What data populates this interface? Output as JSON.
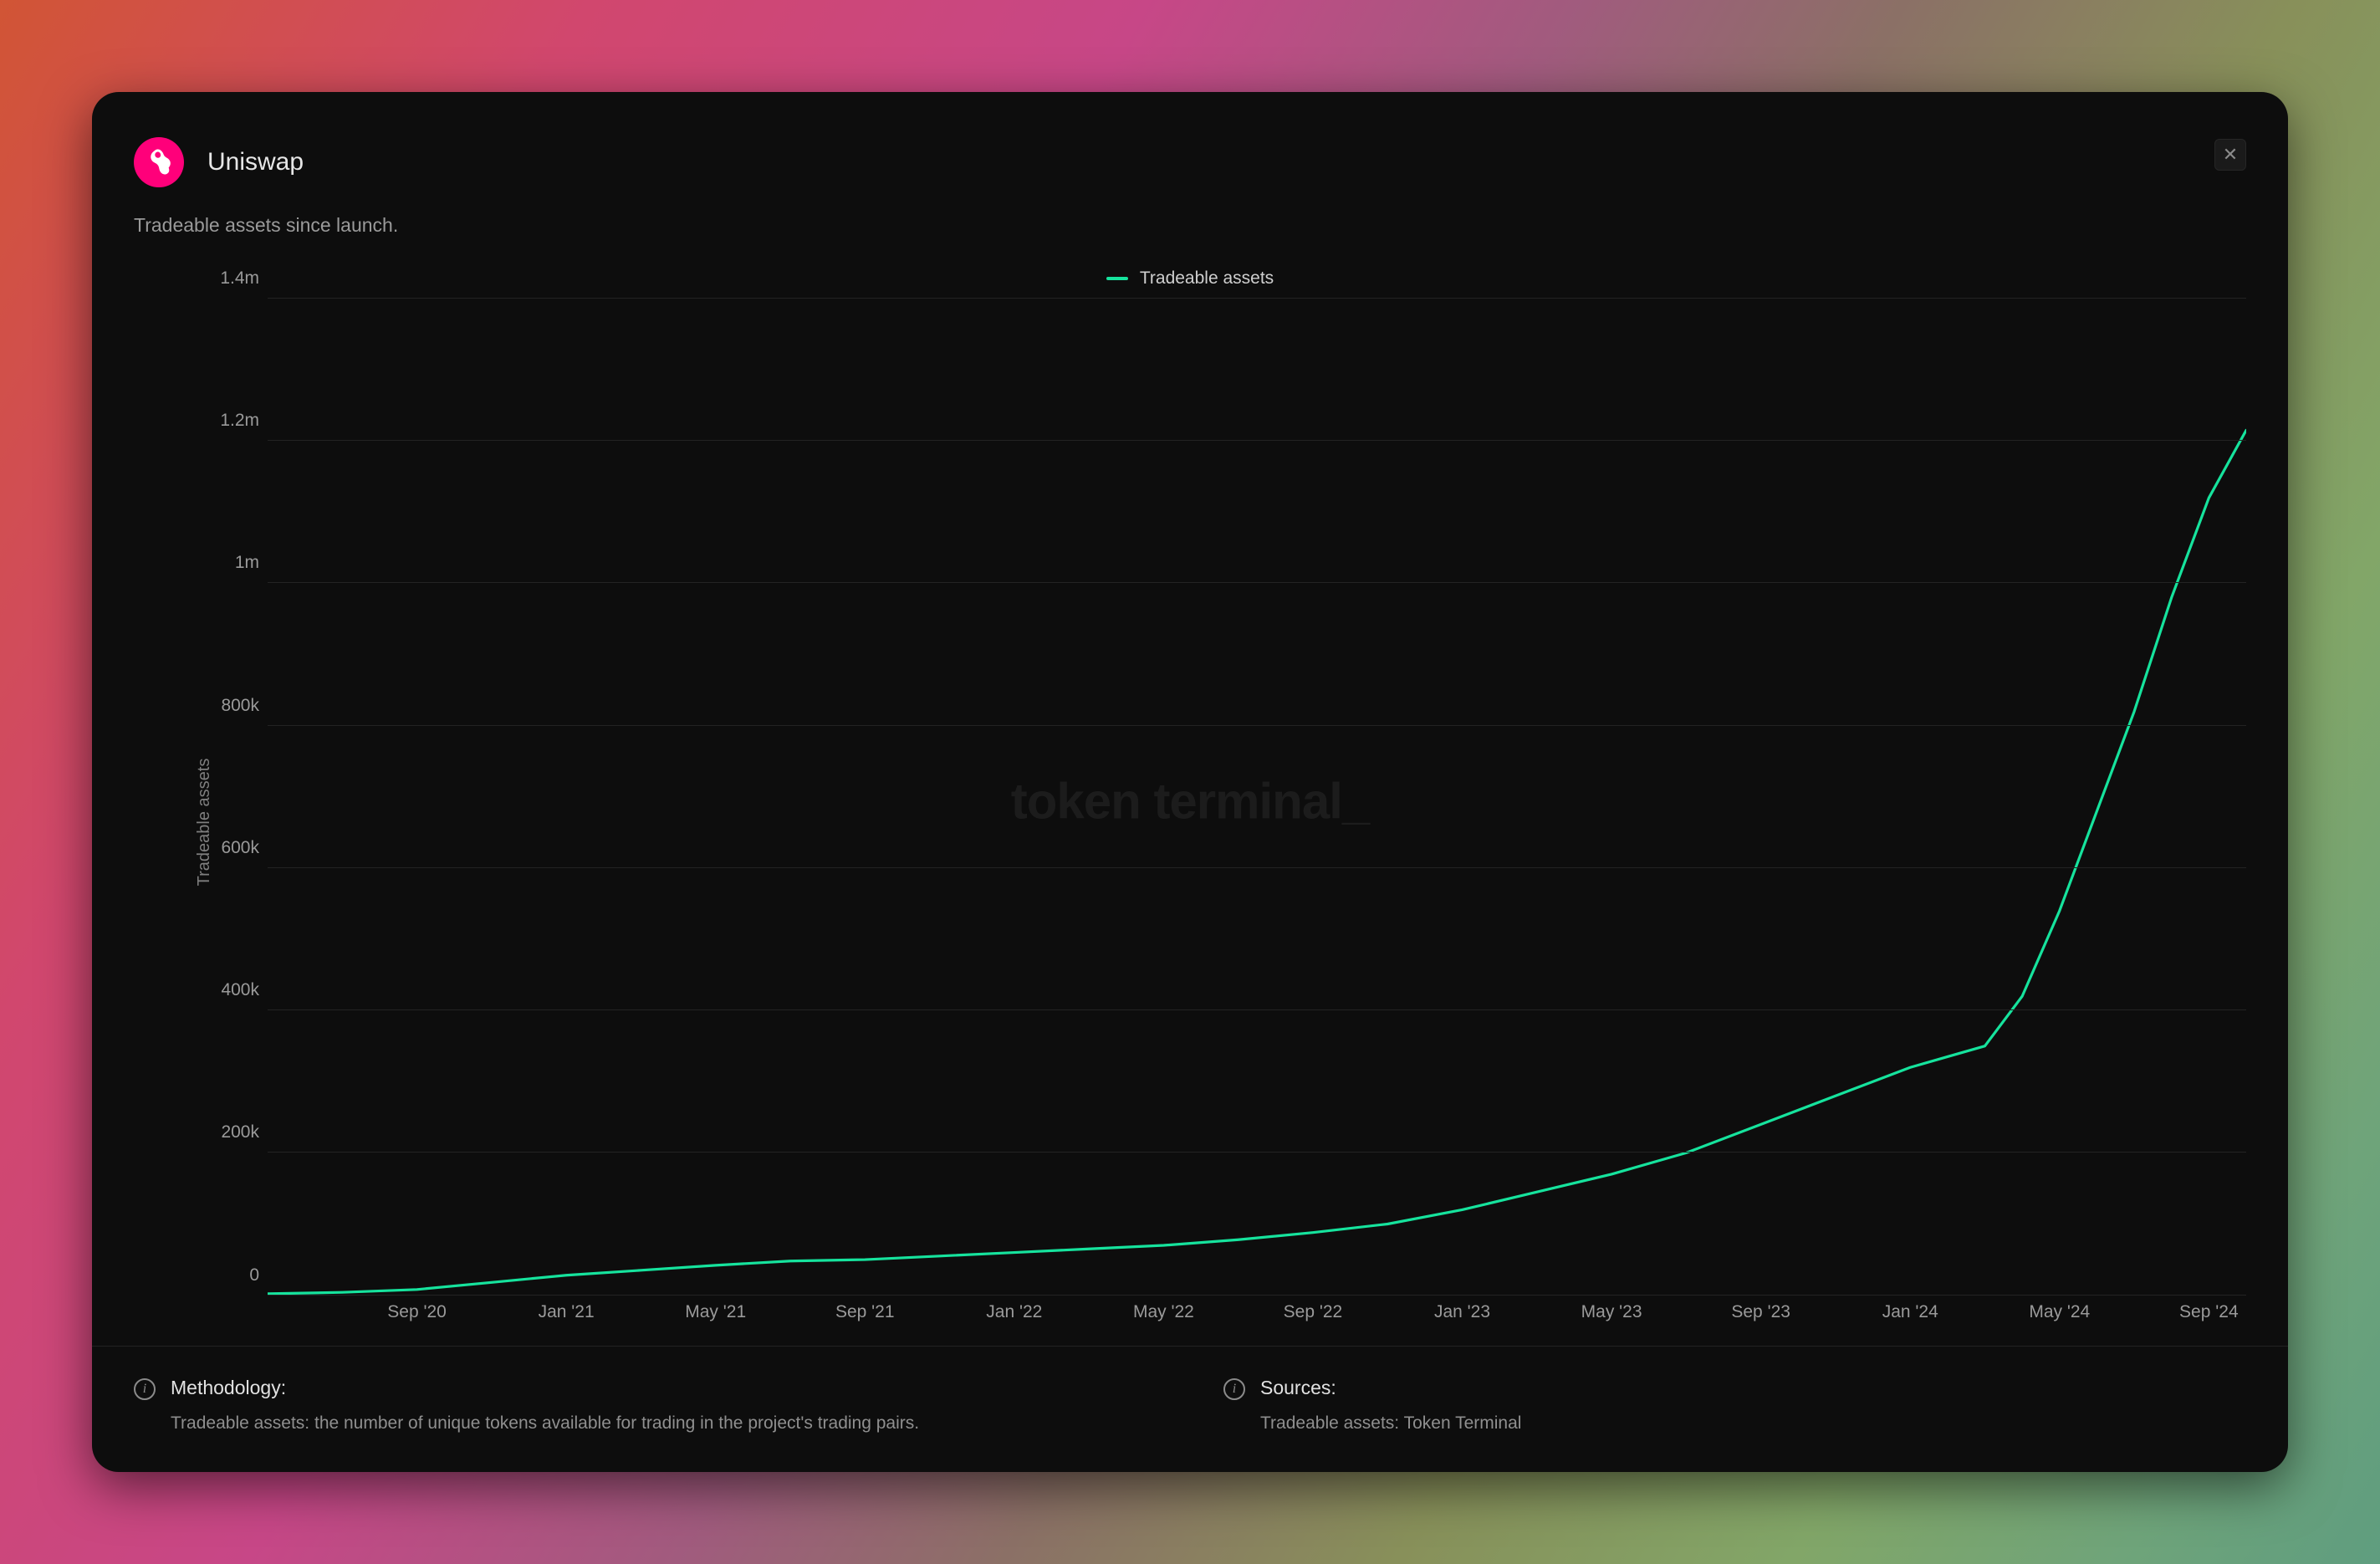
{
  "header": {
    "title": "Uniswap",
    "subtitle": "Tradeable assets since launch."
  },
  "legend": {
    "series_label": "Tradeable assets"
  },
  "watermark": "token terminal_",
  "chart_data": {
    "type": "line",
    "ylabel": "Tradeable assets",
    "xlabel": "",
    "ylim": [
      0,
      1400000
    ],
    "y_ticks": [
      {
        "value": 0,
        "label": "0"
      },
      {
        "value": 200000,
        "label": "200k"
      },
      {
        "value": 400000,
        "label": "400k"
      },
      {
        "value": 600000,
        "label": "600k"
      },
      {
        "value": 800000,
        "label": "800k"
      },
      {
        "value": 1000000,
        "label": "1m"
      },
      {
        "value": 1200000,
        "label": "1.2m"
      },
      {
        "value": 1400000,
        "label": "1.4m"
      }
    ],
    "x_ticks": [
      "Sep '20",
      "Jan '21",
      "May '21",
      "Sep '21",
      "Jan '22",
      "May '22",
      "Sep '22",
      "Jan '23",
      "May '23",
      "Sep '23",
      "Jan '24",
      "May '24",
      "Sep '24"
    ],
    "series": [
      {
        "name": "Tradeable assets",
        "color": "#16e39d",
        "points": [
          {
            "x": "May '20",
            "y": 2000
          },
          {
            "x": "Jul '20",
            "y": 4000
          },
          {
            "x": "Sep '20",
            "y": 8000
          },
          {
            "x": "Nov '20",
            "y": 18000
          },
          {
            "x": "Jan '21",
            "y": 28000
          },
          {
            "x": "Mar '21",
            "y": 35000
          },
          {
            "x": "May '21",
            "y": 42000
          },
          {
            "x": "Jul '21",
            "y": 48000
          },
          {
            "x": "Sep '21",
            "y": 50000
          },
          {
            "x": "Nov '21",
            "y": 55000
          },
          {
            "x": "Jan '22",
            "y": 60000
          },
          {
            "x": "Mar '22",
            "y": 65000
          },
          {
            "x": "May '22",
            "y": 70000
          },
          {
            "x": "Jul '22",
            "y": 78000
          },
          {
            "x": "Sep '22",
            "y": 88000
          },
          {
            "x": "Nov '22",
            "y": 100000
          },
          {
            "x": "Jan '23",
            "y": 120000
          },
          {
            "x": "Mar '23",
            "y": 145000
          },
          {
            "x": "May '23",
            "y": 170000
          },
          {
            "x": "Jul '23",
            "y": 200000
          },
          {
            "x": "Sep '23",
            "y": 240000
          },
          {
            "x": "Nov '23",
            "y": 280000
          },
          {
            "x": "Jan '24",
            "y": 320000
          },
          {
            "x": "Feb '24",
            "y": 335000
          },
          {
            "x": "Mar '24",
            "y": 350000
          },
          {
            "x": "Apr '24",
            "y": 420000
          },
          {
            "x": "May '24",
            "y": 540000
          },
          {
            "x": "Jun '24",
            "y": 680000
          },
          {
            "x": "Jul '24",
            "y": 820000
          },
          {
            "x": "Aug '24",
            "y": 980000
          },
          {
            "x": "Sep '24",
            "y": 1120000
          },
          {
            "x": "Oct '24",
            "y": 1215000
          }
        ]
      }
    ]
  },
  "footer": {
    "methodology": {
      "title": "Methodology:",
      "body": "Tradeable assets: the number of unique tokens available for trading in the project's trading pairs."
    },
    "sources": {
      "title": "Sources:",
      "body": "Tradeable assets: Token Terminal"
    }
  }
}
